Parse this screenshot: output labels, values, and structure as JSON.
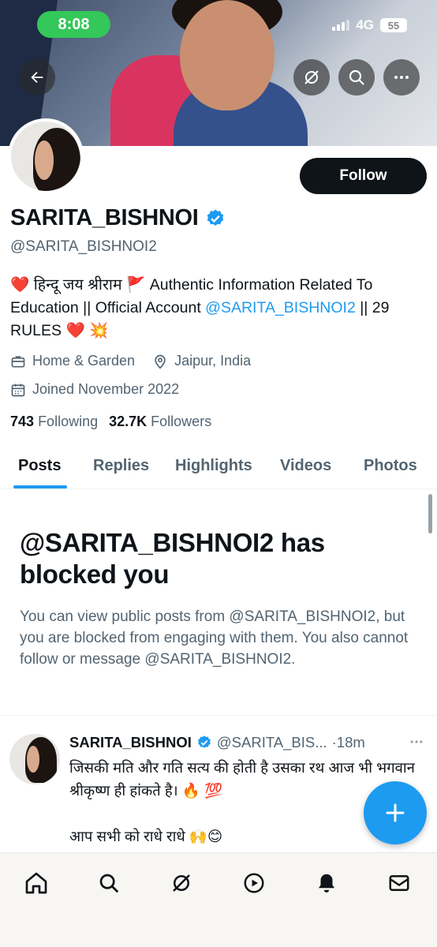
{
  "status_bar": {
    "time": "8:08",
    "network": "4G",
    "battery": "55"
  },
  "profile": {
    "display_name": "SARITA_BISHNOI",
    "handle": "@SARITA_BISHNOI2",
    "follow_label": "Follow",
    "bio_prefix": "❤️ हिन्दू जय श्रीराम 🚩 Authentic Information Related To Education || Official Account ",
    "bio_mention": "@SARITA_BISHNOI2",
    "bio_suffix": " || 29 RULES ❤️ 💥",
    "category": "Home & Garden",
    "location": "Jaipur, India",
    "joined": "Joined November 2022",
    "following_count": "743",
    "following_label": "Following",
    "followers_count": "32.7K",
    "followers_label": "Followers"
  },
  "tabs": [
    "Posts",
    "Replies",
    "Highlights",
    "Videos",
    "Photos"
  ],
  "blocked": {
    "title": "@SARITA_BISHNOI2 has blocked you",
    "body": "You can view public posts from @SARITA_BISHNOI2, but you are blocked from engaging with them. You also cannot follow or message @SARITA_BISHNOI2."
  },
  "tweet": {
    "name": "SARITA_BISHNOI",
    "handle": "@SARITA_BIS...",
    "time": "·18m",
    "line1": "जिसकी मति और गति सत्य की होती है उसका रथ आज भी भगवान श्रीकृष्ण ही हांकते है। 🔥 💯",
    "line2": "आप सभी को राधे राधे 🙌😊"
  },
  "icons": {
    "back": "back-arrow-icon",
    "grok": "grok-icon",
    "search": "search-icon",
    "more": "more-icon",
    "verified": "verified-badge-icon",
    "category": "briefcase-icon",
    "location": "location-pin-icon",
    "calendar": "calendar-icon",
    "compose": "plus-icon",
    "home": "home-icon",
    "nav_search": "search-icon",
    "nav_grok": "grok-icon",
    "play": "play-icon",
    "bell": "bell-icon",
    "mail": "mail-icon"
  },
  "colors": {
    "accent": "#1d9bf0",
    "text": "#0f1419",
    "muted": "#536471",
    "status_green": "#34c759"
  }
}
